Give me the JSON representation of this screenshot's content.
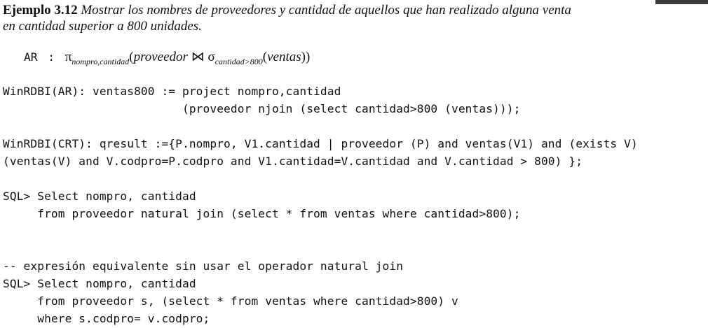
{
  "example": {
    "label": "Ejemplo 3.12",
    "description_line1": "Mostrar los nombres de proveedores y cantidad de aquellos que han realizado alguna venta",
    "description_line2": "en cantidad superior a 800 unidades."
  },
  "algebra": {
    "label": "AR",
    "separator": ":",
    "projection_symbol": "π",
    "projection_attrs": "nompro,cantidad",
    "relation1": "proveedor",
    "join_symbol": "⋈",
    "selection_symbol": "σ",
    "selection_condition": "cantidad>800",
    "relation2": "ventas"
  },
  "code_lines": [
    "WinRDBI(AR): ventas800 := project nompro,cantidad",
    "                          (proveedor njoin (select cantidad>800 (ventas)));",
    "",
    "WinRDBI(CRT): qresult :={P.nompro, V1.cantidad | proveedor (P) and ventas(V1) and (exists V)",
    "(ventas(V) and V.codpro=P.codpro and V1.cantidad=V.cantidad and V.cantidad > 800) };",
    "",
    "SQL> Select nompro, cantidad",
    "     from proveedor natural join (select * from ventas where cantidad>800);",
    "",
    "",
    "-- expresión equivalente sin usar el operador natural join",
    "SQL> Select nompro, cantidad",
    "     from proveedor s, (select * from ventas where cantidad>800) v",
    "     where s.codpro= v.codpro;"
  ]
}
